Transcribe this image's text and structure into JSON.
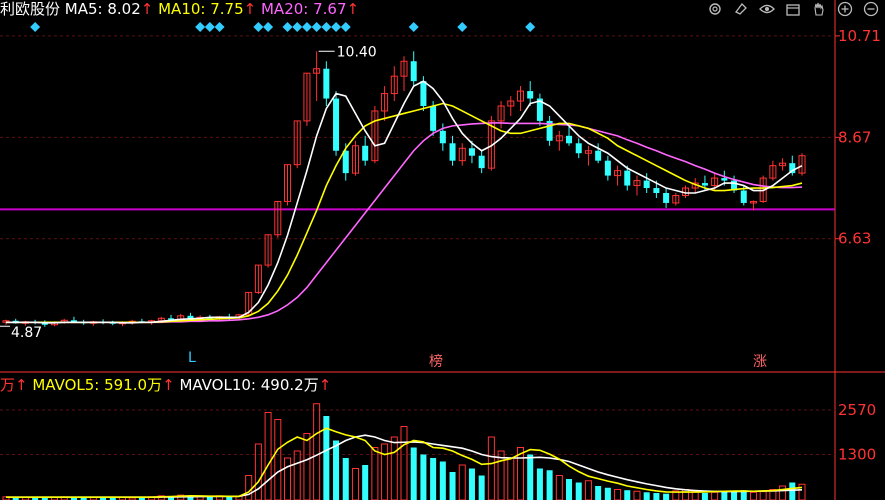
{
  "stock": {
    "name_fragment": "利欧股份"
  },
  "ma_legend": [
    {
      "label": "MA5:",
      "value": "8.02",
      "arrow": "↑",
      "color": "#ffffff"
    },
    {
      "label": "MA10:",
      "value": "7.75",
      "arrow": "↑",
      "color": "#ffff00"
    },
    {
      "label": "MA20:",
      "value": "7.67",
      "arrow": "↑",
      "color": "#ff66ff"
    }
  ],
  "vol_legend": [
    {
      "label": "万",
      "arrow": "↑",
      "color": "#ff3333",
      "value": ""
    },
    {
      "label": "MAVOL5:",
      "value": "591.0万",
      "arrow": "↑",
      "color": "#ffff00"
    },
    {
      "label": "MAVOL10:",
      "value": "490.2万",
      "arrow": "↑",
      "color": "#ffffff"
    }
  ],
  "price_axis": {
    "labels": [
      "10.71",
      "8.67",
      "6.63"
    ]
  },
  "volume_axis": {
    "labels": [
      "2570",
      "1300"
    ]
  },
  "annotations": {
    "high": "10.40",
    "low": "4.87"
  },
  "markers": {
    "m1": "L",
    "m2": "榜",
    "m3": "涨"
  },
  "toolbar": [
    "gear-icon",
    "eraser-icon",
    "eye-icon",
    "box-icon",
    "hand-icon",
    "zoom-in-icon",
    "zoom-out-icon"
  ],
  "colors": {
    "up": "#ff3333",
    "down": "#33ffff",
    "ma5": "#ffffff",
    "ma10": "#ffff00",
    "ma20": "#ff66ff",
    "hline": "#cc00cc",
    "axis": "#ff3333"
  },
  "chart_data": {
    "type": "candlestick",
    "price_range": [
      3.99,
      11.07
    ],
    "horizontal_line_value": 7.22,
    "candles": [
      [
        4.95,
        5.0,
        4.9,
        4.98
      ],
      [
        4.98,
        5.02,
        4.92,
        4.93
      ],
      [
        4.93,
        4.98,
        4.88,
        4.96
      ],
      [
        4.96,
        5.0,
        4.91,
        4.94
      ],
      [
        4.94,
        4.99,
        4.86,
        4.9
      ],
      [
        4.9,
        4.97,
        4.87,
        4.95
      ],
      [
        4.95,
        5.02,
        4.92,
        4.99
      ],
      [
        4.99,
        5.06,
        4.94,
        4.96
      ],
      [
        4.96,
        5.0,
        4.9,
        4.93
      ],
      [
        4.93,
        4.98,
        4.88,
        4.96
      ],
      [
        4.96,
        5.01,
        4.91,
        4.94
      ],
      [
        4.94,
        4.98,
        4.89,
        4.92
      ],
      [
        4.92,
        4.97,
        4.87,
        4.95
      ],
      [
        4.95,
        5.0,
        4.9,
        4.97
      ],
      [
        4.97,
        5.02,
        4.93,
        4.95
      ],
      [
        4.95,
        5.0,
        4.9,
        4.98
      ],
      [
        4.98,
        5.06,
        4.94,
        5.03
      ],
      [
        5.03,
        5.1,
        4.97,
        5.0
      ],
      [
        5.0,
        5.12,
        4.97,
        5.08
      ],
      [
        5.08,
        5.14,
        4.98,
        5.01
      ],
      [
        5.01,
        5.09,
        4.96,
        5.05
      ],
      [
        5.05,
        5.1,
        4.99,
        5.02
      ],
      [
        5.02,
        5.08,
        4.97,
        5.06
      ],
      [
        5.06,
        5.12,
        5.0,
        5.04
      ],
      [
        5.04,
        5.12,
        5.0,
        5.1
      ],
      [
        5.1,
        5.55,
        5.08,
        5.55
      ],
      [
        5.55,
        6.1,
        5.52,
        6.1
      ],
      [
        6.1,
        6.71,
        6.05,
        6.71
      ],
      [
        6.71,
        7.38,
        6.65,
        7.38
      ],
      [
        7.38,
        8.12,
        7.3,
        8.12
      ],
      [
        8.12,
        9.0,
        8.05,
        9.0
      ],
      [
        9.0,
        9.96,
        8.9,
        9.96
      ],
      [
        9.96,
        10.4,
        9.4,
        10.05
      ],
      [
        10.05,
        10.2,
        9.3,
        9.45
      ],
      [
        9.45,
        9.6,
        8.3,
        8.4
      ],
      [
        8.4,
        8.55,
        7.8,
        7.95
      ],
      [
        7.95,
        8.6,
        7.9,
        8.5
      ],
      [
        8.5,
        8.7,
        8.1,
        8.2
      ],
      [
        8.2,
        9.3,
        8.15,
        9.2
      ],
      [
        9.2,
        9.7,
        9.0,
        9.55
      ],
      [
        9.55,
        10.1,
        9.4,
        9.9
      ],
      [
        9.9,
        10.3,
        9.6,
        10.2
      ],
      [
        10.2,
        10.4,
        9.7,
        9.8
      ],
      [
        9.8,
        9.9,
        9.2,
        9.3
      ],
      [
        9.3,
        9.4,
        8.7,
        8.8
      ],
      [
        8.8,
        8.95,
        8.4,
        8.55
      ],
      [
        8.55,
        8.7,
        8.1,
        8.2
      ],
      [
        8.2,
        8.55,
        8.1,
        8.45
      ],
      [
        8.45,
        8.6,
        8.15,
        8.3
      ],
      [
        8.3,
        8.4,
        7.95,
        8.05
      ],
      [
        8.05,
        9.1,
        8.0,
        9.0
      ],
      [
        9.0,
        9.4,
        8.85,
        9.3
      ],
      [
        9.3,
        9.5,
        9.1,
        9.4
      ],
      [
        9.4,
        9.7,
        9.2,
        9.6
      ],
      [
        9.6,
        9.8,
        9.3,
        9.45
      ],
      [
        9.45,
        9.55,
        8.9,
        9.0
      ],
      [
        9.0,
        9.1,
        8.5,
        8.6
      ],
      [
        8.6,
        8.8,
        8.4,
        8.7
      ],
      [
        8.7,
        8.9,
        8.5,
        8.55
      ],
      [
        8.55,
        8.65,
        8.25,
        8.35
      ],
      [
        8.35,
        8.5,
        8.1,
        8.4
      ],
      [
        8.4,
        8.55,
        8.15,
        8.2
      ],
      [
        8.2,
        8.3,
        7.8,
        7.9
      ],
      [
        7.9,
        8.1,
        7.7,
        8.0
      ],
      [
        8.0,
        8.1,
        7.6,
        7.7
      ],
      [
        7.7,
        7.9,
        7.5,
        7.8
      ],
      [
        7.8,
        7.95,
        7.55,
        7.65
      ],
      [
        7.65,
        7.8,
        7.45,
        7.55
      ],
      [
        7.55,
        7.65,
        7.25,
        7.35
      ],
      [
        7.35,
        7.55,
        7.3,
        7.5
      ],
      [
        7.5,
        7.7,
        7.45,
        7.65
      ],
      [
        7.65,
        7.85,
        7.55,
        7.75
      ],
      [
        7.75,
        7.9,
        7.6,
        7.7
      ],
      [
        7.7,
        7.95,
        7.6,
        7.85
      ],
      [
        7.85,
        8.0,
        7.7,
        7.8
      ],
      [
        7.8,
        7.9,
        7.55,
        7.6
      ],
      [
        7.6,
        7.7,
        7.3,
        7.35
      ],
      [
        7.35,
        7.4,
        7.2,
        7.38
      ],
      [
        7.38,
        7.9,
        7.35,
        7.85
      ],
      [
        7.85,
        8.2,
        7.8,
        8.1
      ],
      [
        8.1,
        8.25,
        8.0,
        8.15
      ],
      [
        8.15,
        8.3,
        7.9,
        7.95
      ],
      [
        7.95,
        8.35,
        7.9,
        8.3
      ]
    ],
    "ma5": [
      4.95,
      4.95,
      4.95,
      4.95,
      4.94,
      4.94,
      4.95,
      4.95,
      4.95,
      4.95,
      4.95,
      4.95,
      4.94,
      4.94,
      4.95,
      4.95,
      4.97,
      4.99,
      5.01,
      5.02,
      5.03,
      5.05,
      5.05,
      5.05,
      5.05,
      5.15,
      5.35,
      5.7,
      6.15,
      6.7,
      7.35,
      8.0,
      8.7,
      9.25,
      9.55,
      9.5,
      9.15,
      8.8,
      8.5,
      8.55,
      8.95,
      9.35,
      9.7,
      9.8,
      9.65,
      9.4,
      9.05,
      8.75,
      8.55,
      8.4,
      8.5,
      8.65,
      8.85,
      9.05,
      9.35,
      9.4,
      9.3,
      9.1,
      8.9,
      8.7,
      8.55,
      8.45,
      8.35,
      8.2,
      8.05,
      7.95,
      7.85,
      7.75,
      7.65,
      7.6,
      7.55,
      7.55,
      7.6,
      7.65,
      7.75,
      7.75,
      7.7,
      7.6,
      7.6,
      7.7,
      7.85,
      8.0,
      8.1
    ],
    "ma10": [
      4.95,
      4.95,
      4.95,
      4.95,
      4.95,
      4.95,
      4.95,
      4.95,
      4.95,
      4.95,
      4.95,
      4.95,
      4.95,
      4.95,
      4.95,
      4.95,
      4.96,
      4.97,
      4.98,
      4.99,
      5.0,
      5.01,
      5.02,
      5.03,
      5.04,
      5.08,
      5.17,
      5.33,
      5.58,
      5.9,
      6.3,
      6.75,
      7.2,
      7.7,
      8.1,
      8.45,
      8.7,
      8.9,
      9.0,
      9.05,
      9.1,
      9.15,
      9.2,
      9.25,
      9.3,
      9.35,
      9.3,
      9.2,
      9.1,
      9.0,
      8.9,
      8.8,
      8.75,
      8.75,
      8.8,
      8.85,
      8.9,
      8.95,
      8.95,
      8.9,
      8.85,
      8.75,
      8.65,
      8.5,
      8.4,
      8.3,
      8.2,
      8.1,
      8.0,
      7.9,
      7.8,
      7.72,
      7.65,
      7.6,
      7.6,
      7.62,
      7.64,
      7.65,
      7.65,
      7.66,
      7.68,
      7.7,
      7.75
    ],
    "ma20": [
      4.95,
      4.95,
      4.95,
      4.95,
      4.95,
      4.95,
      4.95,
      4.95,
      4.95,
      4.95,
      4.95,
      4.95,
      4.95,
      4.95,
      4.95,
      4.95,
      4.95,
      4.96,
      4.96,
      4.97,
      4.97,
      4.98,
      4.98,
      4.99,
      5.0,
      5.02,
      5.05,
      5.1,
      5.18,
      5.3,
      5.45,
      5.65,
      5.9,
      6.15,
      6.4,
      6.65,
      6.9,
      7.15,
      7.4,
      7.65,
      7.9,
      8.15,
      8.4,
      8.6,
      8.75,
      8.85,
      8.9,
      8.92,
      8.94,
      8.95,
      8.96,
      8.96,
      8.95,
      8.95,
      8.95,
      8.95,
      8.94,
      8.93,
      8.92,
      8.9,
      8.85,
      8.8,
      8.75,
      8.7,
      8.62,
      8.55,
      8.47,
      8.4,
      8.32,
      8.25,
      8.18,
      8.1,
      8.03,
      7.95,
      7.88,
      7.82,
      7.77,
      7.72,
      7.69,
      7.67,
      7.66,
      7.66,
      7.67
    ],
    "volume_range": [
      0,
      3000
    ],
    "volume": [
      90,
      80,
      70,
      85,
      60,
      75,
      90,
      100,
      80,
      85,
      70,
      65,
      75,
      60,
      80,
      90,
      120,
      100,
      140,
      110,
      100,
      90,
      120,
      95,
      110,
      700,
      1600,
      2500,
      2300,
      1200,
      1400,
      1900,
      2750,
      2400,
      1700,
      1200,
      900,
      1000,
      1500,
      1600,
      1800,
      2100,
      1500,
      1300,
      1200,
      1100,
      800,
      1000,
      900,
      700,
      1800,
      1400,
      1200,
      1500,
      1300,
      900,
      850,
      700,
      600,
      500,
      550,
      400,
      350,
      300,
      280,
      250,
      220,
      200,
      180,
      260,
      300,
      250,
      200,
      220,
      260,
      240,
      280,
      220,
      240,
      300,
      400,
      500,
      450
    ],
    "mavol5": [
      80,
      80,
      80,
      80,
      80,
      80,
      80,
      80,
      80,
      80,
      80,
      80,
      80,
      80,
      80,
      80,
      90,
      100,
      110,
      120,
      115,
      110,
      108,
      105,
      103,
      230,
      520,
      1000,
      1450,
      1650,
      1800,
      1700,
      1900,
      2050,
      1950,
      1860,
      1800,
      1700,
      1400,
      1300,
      1360,
      1580,
      1700,
      1660,
      1500,
      1480,
      1400,
      1270,
      1160,
      1020,
      1040,
      1120,
      1180,
      1320,
      1440,
      1420,
      1310,
      1170,
      970,
      810,
      680,
      610,
      540,
      480,
      400,
      350,
      300,
      260,
      230,
      225,
      230,
      225,
      230,
      240,
      250,
      255,
      260,
      250,
      260,
      270,
      300,
      330,
      360
    ],
    "mavol10": [
      80,
      80,
      80,
      80,
      80,
      80,
      80,
      80,
      80,
      80,
      80,
      80,
      80,
      80,
      80,
      80,
      85,
      88,
      92,
      95,
      98,
      100,
      102,
      104,
      106,
      160,
      320,
      560,
      800,
      950,
      1050,
      1150,
      1280,
      1420,
      1550,
      1700,
      1800,
      1850,
      1800,
      1700,
      1640,
      1650,
      1660,
      1640,
      1600,
      1560,
      1520,
      1480,
      1400,
      1300,
      1240,
      1210,
      1200,
      1200,
      1210,
      1220,
      1200,
      1160,
      1100,
      1000,
      900,
      800,
      720,
      650,
      580,
      520,
      460,
      410,
      360,
      320,
      290,
      270,
      255,
      245,
      240,
      240,
      245,
      250,
      255,
      260,
      270,
      280,
      290
    ]
  }
}
